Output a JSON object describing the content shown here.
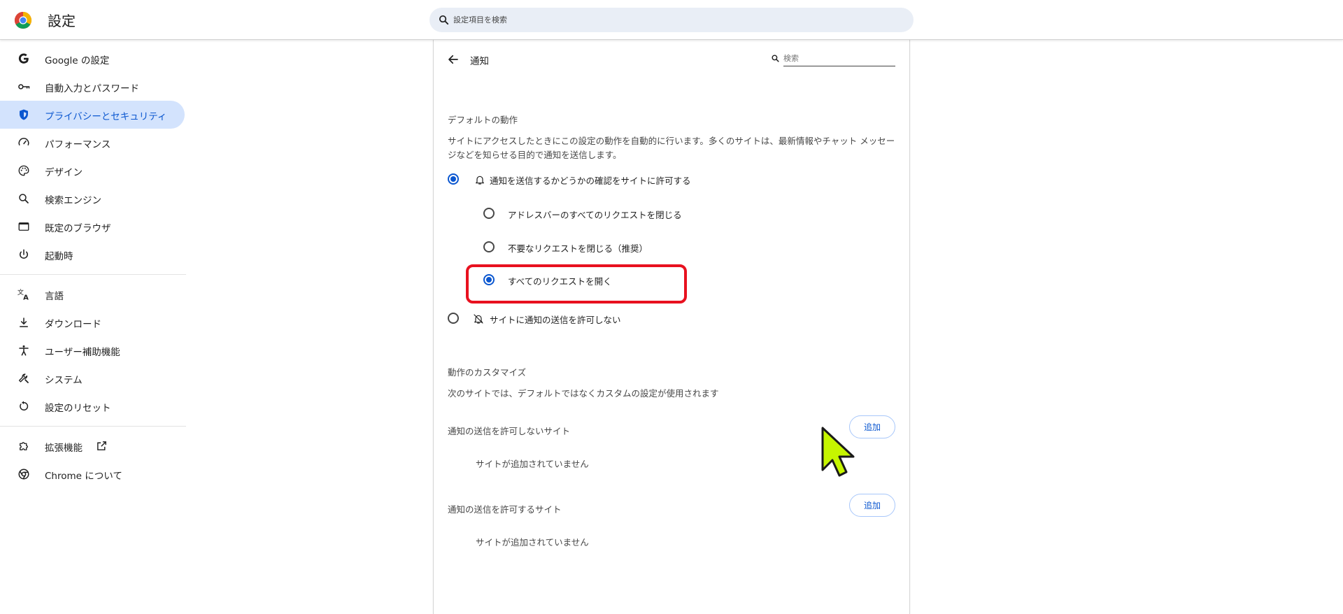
{
  "header": {
    "title": "設定",
    "search_placeholder": "設定項目を検索"
  },
  "sidebar": {
    "items": [
      {
        "label": "Google の設定",
        "icon": "google-icon"
      },
      {
        "label": "自動入力とパスワード",
        "icon": "key-icon"
      },
      {
        "label": "プライバシーとセキュリティ",
        "icon": "shield-icon",
        "active": true
      },
      {
        "label": "パフォーマンス",
        "icon": "speedometer-icon"
      },
      {
        "label": "デザイン",
        "icon": "palette-icon"
      },
      {
        "label": "検索エンジン",
        "icon": "search-icon"
      },
      {
        "label": "既定のブラウザ",
        "icon": "browser-window-icon"
      },
      {
        "label": "起動時",
        "icon": "power-icon"
      },
      {
        "label": "言語",
        "icon": "translate-icon"
      },
      {
        "label": "ダウンロード",
        "icon": "download-icon"
      },
      {
        "label": "ユーザー補助機能",
        "icon": "accessibility-icon"
      },
      {
        "label": "システム",
        "icon": "wrench-icon"
      },
      {
        "label": "設定のリセット",
        "icon": "reset-icon"
      },
      {
        "label": "拡張機能",
        "icon": "puzzle-icon"
      },
      {
        "label": "Chrome について",
        "icon": "chrome-icon"
      }
    ]
  },
  "main": {
    "title": "通知",
    "search_placeholder": "検索",
    "default_behavior": {
      "title": "デフォルトの動作",
      "description": "サイトにアクセスしたときにこの設定の動作を自動的に行います。多くのサイトは、最新情報やチャット メッセージなどを知らせる目的で通知を送信します。",
      "options": {
        "allow_ask": "通知を送信するかどうかの確認をサイトに許可する",
        "quiet_all": "アドレスバーのすべてのリクエストを閉じる",
        "quiet_unwanted": "不要なリクエストを閉じる（推奨）",
        "expand_all": "すべてのリクエストを開く",
        "block": "サイトに通知の送信を許可しない"
      }
    },
    "customize": {
      "title": "動作のカスタマイズ",
      "description": "次のサイトでは、デフォルトではなくカスタムの設定が使用されます",
      "blocked_label": "通知の送信を許可しないサイト",
      "allowed_label": "通知の送信を許可するサイト",
      "add_label": "追加",
      "empty_text": "サイトが追加されていません"
    }
  },
  "colors": {
    "accent": "#0b57d0",
    "active_nav_bg": "#d3e3fd",
    "highlight": "#e8111f",
    "cursor": "#c6f500"
  }
}
